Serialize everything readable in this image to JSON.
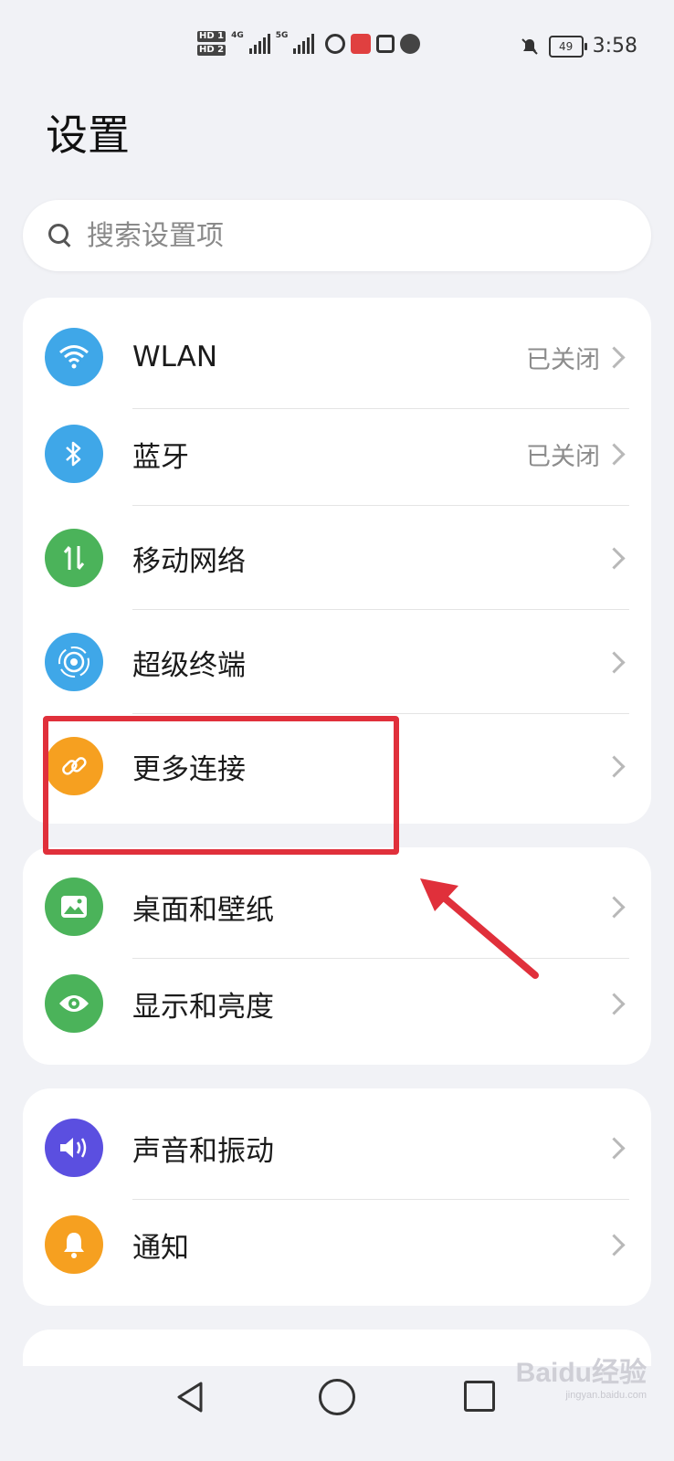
{
  "status_bar": {
    "hd1": "HD 1",
    "hd2": "HD 2",
    "net1": "4G",
    "net2": "5G",
    "battery": "49",
    "time": "3:58"
  },
  "page_title": "设置",
  "search": {
    "placeholder": "搜索设置项"
  },
  "groups": [
    {
      "items": [
        {
          "label": "WLAN",
          "value": "已关闭",
          "icon": "wifi-icon",
          "color": "#3fa7e8"
        },
        {
          "label": "蓝牙",
          "value": "已关闭",
          "icon": "bluetooth-icon",
          "color": "#3fa7e8"
        },
        {
          "label": "移动网络",
          "value": "",
          "icon": "mobile-data-icon",
          "color": "#4bb35a"
        },
        {
          "label": "超级终端",
          "value": "",
          "icon": "super-device-icon",
          "color": "#3fa7e8"
        },
        {
          "label": "更多连接",
          "value": "",
          "icon": "link-icon",
          "color": "#f6a020"
        }
      ]
    },
    {
      "items": [
        {
          "label": "桌面和壁纸",
          "value": "",
          "icon": "wallpaper-icon",
          "color": "#4bb35a"
        },
        {
          "label": "显示和亮度",
          "value": "",
          "icon": "eye-icon",
          "color": "#4bb35a"
        }
      ]
    },
    {
      "items": [
        {
          "label": "声音和振动",
          "value": "",
          "icon": "sound-icon",
          "color": "#5b4fe0"
        },
        {
          "label": "通知",
          "value": "",
          "icon": "bell-icon",
          "color": "#f6a020"
        }
      ]
    }
  ],
  "watermark": {
    "text": "Baidu经验",
    "sub": "jingyan.baidu.com"
  },
  "colors": {
    "highlight": "#e0303b",
    "background": "#f1f2f6"
  }
}
